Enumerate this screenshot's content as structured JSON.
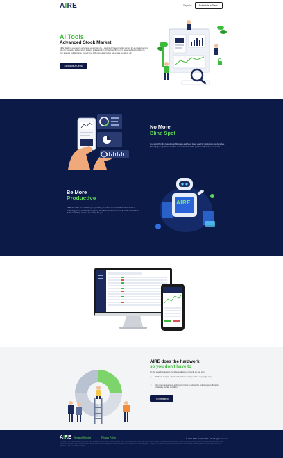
{
  "header": {
    "logo_a": "A",
    "logo_i": "I",
    "logo_re": "RE",
    "signin": "Sign In",
    "demo_button": "Schedule a Demo"
  },
  "hero": {
    "title": "AI Tools",
    "subtitle": "Advanced Stock Market",
    "description": "AIRE Wealth is a research service on subscription by a credible AV based market service for an intellectual and with the thoughtful and excellent features and analytical architecture. Bring more advanced stock trading to your analysis and decisions. Upload your AIRE into stock market with a safe, excellent, etc.",
    "cta": "Schedule A Demo"
  },
  "dark": {
    "blind_title": "No More",
    "blind_highlight": "Blind Spot",
    "blind_text": "Our algorithm the based over 60 years and have been used by institutions for decades. Managing a significant number of assets and on the portfolio tailored to our clients.",
    "productive_title": "Be More",
    "productive_highlight": "Productive",
    "productive_text": "AIRE does the research for you, provide you with the actual information and our technology take control of everything. Our AI tools will immediately make the traders decision making and put the timing for you.",
    "robot_label": "AIRE"
  },
  "hardwork": {
    "title": "AIRE does the hardwork",
    "highlight": "so you don't have to",
    "lead": "It's the wealth manager that's been always on track, so you can:",
    "items": [
      "AIRE will analyze, check and produce and you with every single day.",
      "Our new management technology helps to deliver the optimal asset allocation under any market condition."
    ],
    "cta": "I'm Interested"
  },
  "footer": {
    "logo_a": "A",
    "logo_i": "I",
    "logo_re": "RE",
    "terms": "Terms of Service",
    "privacy": "Privacy Policy",
    "copyright": "© 2021 AIRE Capital 2021 Ltd. All rights reserved.",
    "disclaimer": "Investing in securities involves risks, and there is always the potential of losing money when you invest in securities. Past performance does not guarantee future results. Before investing consider your investment objectives and AIRE fees and expenses. AIRE's internet-based advisory services are designed to assist clients in achieving discrete financial goals. They are not intended to provide comprehensive tax advice or financial planning with respect to every aspect of a client's financial situation."
  },
  "colors": {
    "navy": "#0c1a47",
    "green": "#3dbb3a",
    "light_green": "#5fd35a"
  }
}
